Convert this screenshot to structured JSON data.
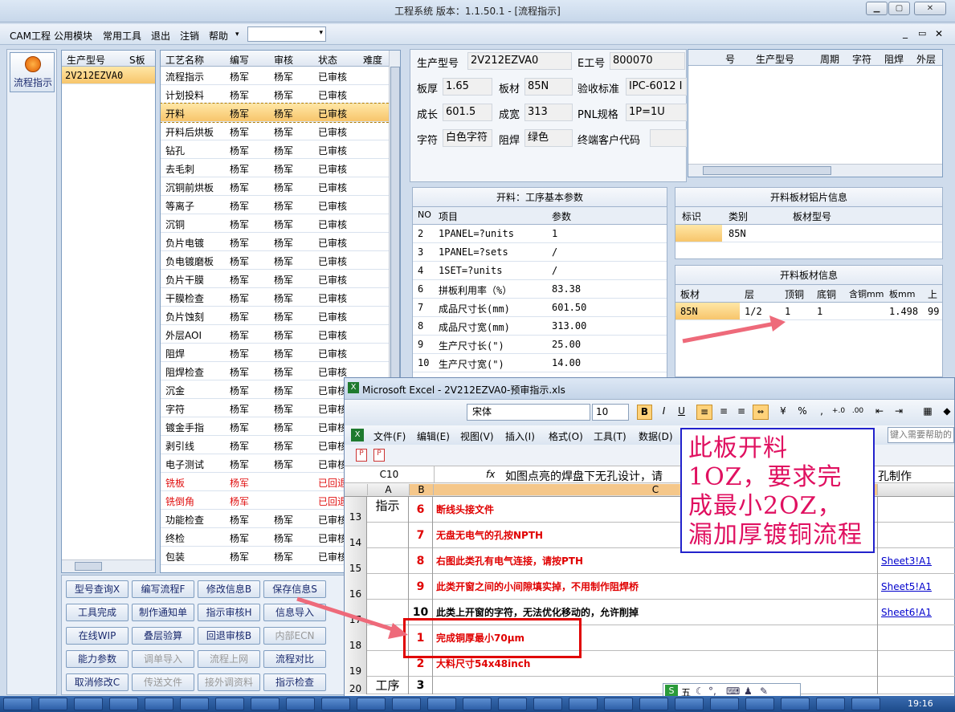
{
  "window": {
    "title": "工程系统   版本：1.1.50.1 - [流程指示]"
  },
  "menu": [
    "CAM工程",
    "公用模块",
    "常用工具",
    "退出",
    "注销",
    "帮助"
  ],
  "left_panel": {
    "label": "流程指示"
  },
  "model_list": {
    "headers": [
      "生产型号",
      "S板"
    ],
    "rows": [
      [
        "2V212EZVA0",
        ""
      ]
    ]
  },
  "process_list": {
    "headers": [
      "工艺名称",
      "编写",
      "审核",
      "状态",
      "难度"
    ],
    "rows": [
      [
        "流程指示",
        "杨军",
        "杨军",
        "已审核"
      ],
      [
        "计划投料",
        "杨军",
        "杨军",
        "已审核"
      ],
      [
        "开料",
        "杨军",
        "杨军",
        "已审核"
      ],
      [
        "开料后烘板",
        "杨军",
        "杨军",
        "已审核"
      ],
      [
        "钻孔",
        "杨军",
        "杨军",
        "已审核"
      ],
      [
        "去毛刺",
        "杨军",
        "杨军",
        "已审核"
      ],
      [
        "沉铜前烘板",
        "杨军",
        "杨军",
        "已审核"
      ],
      [
        "等离子",
        "杨军",
        "杨军",
        "已审核"
      ],
      [
        "沉铜",
        "杨军",
        "杨军",
        "已审核"
      ],
      [
        "负片电镀",
        "杨军",
        "杨军",
        "已审核"
      ],
      [
        "负电镀磨板",
        "杨军",
        "杨军",
        "已审核"
      ],
      [
        "负片干膜",
        "杨军",
        "杨军",
        "已审核"
      ],
      [
        "干膜检查",
        "杨军",
        "杨军",
        "已审核"
      ],
      [
        "负片蚀刻",
        "杨军",
        "杨军",
        "已审核"
      ],
      [
        "外层AOI",
        "杨军",
        "杨军",
        "已审核"
      ],
      [
        "阻焊",
        "杨军",
        "杨军",
        "已审核"
      ],
      [
        "阻焊检查",
        "杨军",
        "杨军",
        "已审核"
      ],
      [
        "沉金",
        "杨军",
        "杨军",
        "已审核"
      ],
      [
        "字符",
        "杨军",
        "杨军",
        "已审核"
      ],
      [
        "镀金手指",
        "杨军",
        "杨军",
        "已审核"
      ],
      [
        "剥引线",
        "杨军",
        "杨军",
        "已审核"
      ],
      [
        "电子测试",
        "杨军",
        "杨军",
        "已审核"
      ],
      [
        "铣板",
        "杨军",
        "",
        "已回退"
      ],
      [
        "铣倒角",
        "杨军",
        "",
        "已回退"
      ],
      [
        "功能检查",
        "杨军",
        "杨军",
        "已审核"
      ],
      [
        "终检",
        "杨军",
        "杨军",
        "已审核"
      ],
      [
        "包装",
        "杨军",
        "杨军",
        "已审核"
      ]
    ],
    "selected": 2,
    "red_rows": [
      22,
      23
    ]
  },
  "buttons": [
    [
      "型号查询X",
      "编写流程F",
      "修改信息B",
      "保存信息S"
    ],
    [
      "工具完成",
      "制作通知单",
      "指示审核H",
      "信息导入"
    ],
    [
      "在线WIP",
      "叠层验算",
      "回退审核B",
      "内部ECN"
    ],
    [
      "能力参数",
      "调单导入",
      "流程上网",
      "流程对比"
    ],
    [
      "取消修改C",
      "传送文件",
      "接外调资料",
      "指示检查"
    ]
  ],
  "disabled_buttons": [
    "内部ECN",
    "调单导入",
    "流程上网",
    "传送文件",
    "接外调资料"
  ],
  "info": {
    "labels": [
      "生产型号",
      "E工号",
      "板厚",
      "板材",
      "验收标准",
      "成长",
      "成宽",
      "PNL规格",
      "字符",
      "阻焊",
      "终端客户代码"
    ],
    "values": {
      "model": "2V212EZVA0",
      "eno": "800070",
      "thick": "1.65",
      "mat": "85N",
      "std": "IPC-6012 I",
      "len": "601.5",
      "wid": "313",
      "pnl": "1P=1U",
      "char": "白色字符",
      "mask": "绿色"
    }
  },
  "history_grid": {
    "headers": [
      "号",
      "生产型号",
      "周期",
      "字符",
      "阻焊",
      "外层"
    ]
  },
  "params": {
    "title": "开料：工序基本参数",
    "headers": [
      "NO",
      "项目",
      "参数"
    ],
    "rows": [
      [
        "2",
        "1PANEL=?units",
        "1"
      ],
      [
        "3",
        "1PANEL=?sets",
        "/"
      ],
      [
        "4",
        "1SET=?units",
        "/"
      ],
      [
        "6",
        "拼板利用率（%）",
        "83.38"
      ],
      [
        "7",
        "成品尺寸长(mm)",
        "601.50"
      ],
      [
        "8",
        "成品尺寸宽(mm)",
        "313.00"
      ],
      [
        "9",
        "生产尺寸长(\")",
        "25.00"
      ],
      [
        "10",
        "生产尺寸宽(\")",
        "14.00"
      ]
    ]
  },
  "alum": {
    "title": "开料板材铝片信息",
    "headers": [
      "标识",
      "类别",
      "板材型号"
    ],
    "row": [
      "",
      "85N",
      ""
    ]
  },
  "board": {
    "title": "开料板材信息",
    "headers": [
      "板材",
      "层",
      "顶铜",
      "底铜",
      "含铜mm",
      "板mm",
      "上"
    ],
    "row": [
      "85N",
      "1/2",
      "1",
      "1",
      "",
      "1.498",
      "99"
    ]
  },
  "excel": {
    "title": "Microsoft Excel - 2V212EZVA0-预审指示.xls",
    "font": "宋体",
    "size": "10",
    "menu": [
      "文件(F)",
      "编辑(E)",
      "视图(V)",
      "插入(I)",
      "格式(O)",
      "工具(T)",
      "数据(D)"
    ],
    "help_hint": "键入需要帮助的",
    "cellref": "C10",
    "formula": "如图点亮的焊盘下无孔设计，请",
    "formula_tail": "孔制作",
    "cols": [
      "A",
      "B",
      "C"
    ],
    "rows": [
      {
        "n": "13",
        "a": "指示",
        "b": "6",
        "c": "断线头接文件",
        "link": ""
      },
      {
        "n": "14",
        "a": "",
        "b": "7",
        "c": "无盘无电气的孔按NPTH",
        "link": ""
      },
      {
        "n": "15",
        "a": "",
        "b": "8",
        "c": "右图此类孔有电气连接，请按PTH",
        "link": "Sheet3!A1"
      },
      {
        "n": "16",
        "a": "",
        "b": "9",
        "c": "此类开窗之间的小间隙填实掉，不用制作阻焊桥",
        "link": "Sheet5!A1"
      },
      {
        "n": "17",
        "a": "",
        "b": "10",
        "c": "此类上开窗的字符，无法优化移动的，允许削掉",
        "link": "Sheet6!A1"
      },
      {
        "n": "18",
        "a": "",
        "b": "1",
        "c": "完成铜厚最小70μm",
        "link": ""
      },
      {
        "n": "19",
        "a": "",
        "b": "2",
        "c": "大料尺寸54x48inch",
        "link": ""
      },
      {
        "n": "20",
        "a": "工序",
        "b": "3",
        "c": "",
        "link": ""
      }
    ]
  },
  "annotation": "此板开料1OZ，要求完成最小2OZ，漏加厚镀铜流程",
  "ime": "五",
  "clock": "19:16"
}
